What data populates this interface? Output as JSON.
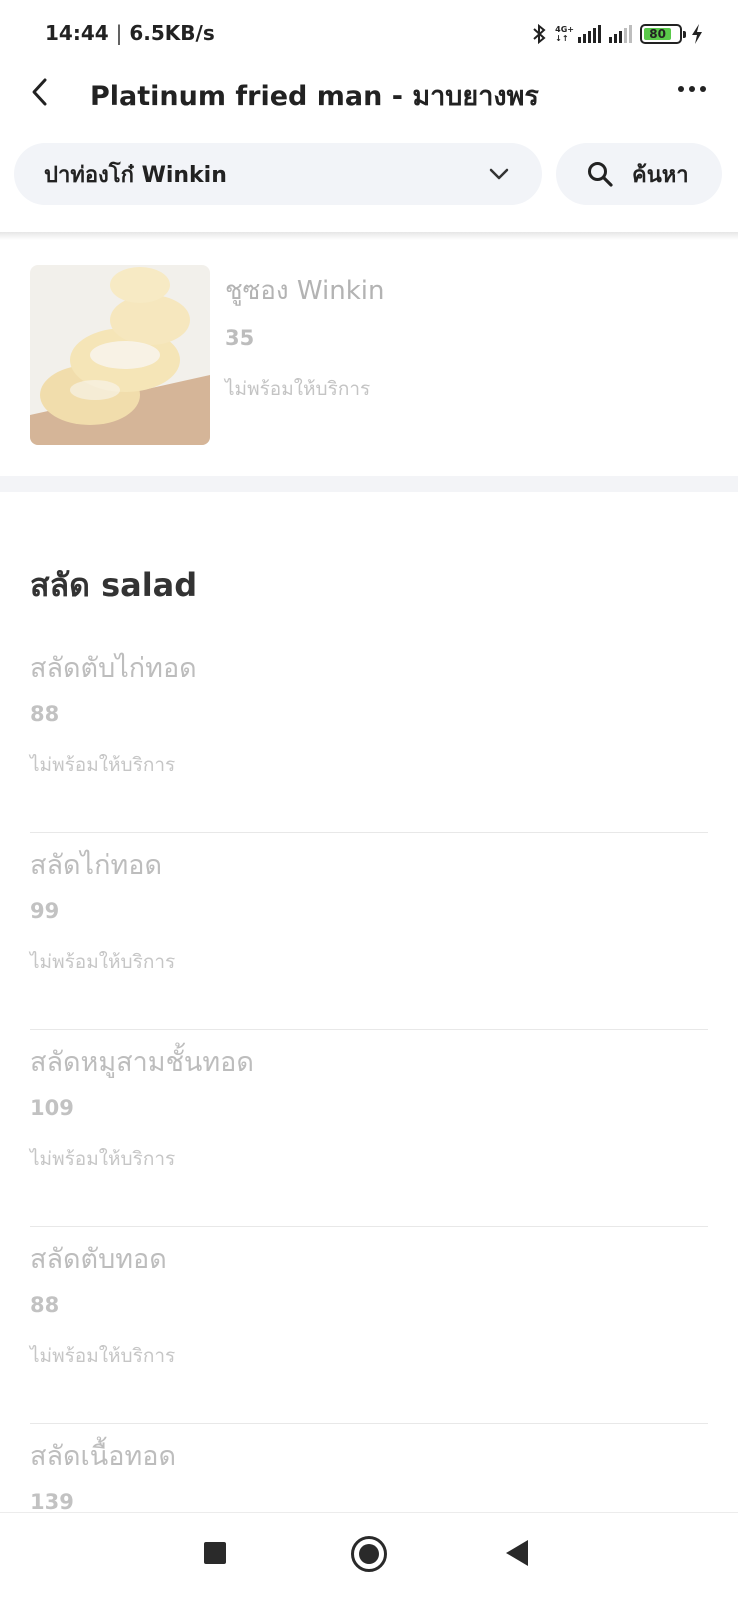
{
  "status_bar": {
    "time": "14:44",
    "separator": "|",
    "network_speed": "6.5KB/s",
    "network_type_top": "4G+",
    "network_type_bottom": "↓↑",
    "battery_level": "80",
    "icons": [
      "bluetooth-icon",
      "signal-4g-icon",
      "signal-icon",
      "battery-icon",
      "charging-icon"
    ]
  },
  "top_nav": {
    "title": "Platinum fried man - มาบยางพร"
  },
  "filter": {
    "category_value": "ปาท่องโก๋ Winkin",
    "search_label": "ค้นหา"
  },
  "featured_item": {
    "name": "ชูซอง Winkin",
    "price": "35",
    "status": "ไม่พร้อมให้บริการ"
  },
  "section": {
    "title": "สลัด salad",
    "items": [
      {
        "name": "สลัดตับไก่ทอด",
        "price": "88",
        "status": "ไม่พร้อมให้บริการ"
      },
      {
        "name": "สลัดไก่ทอด",
        "price": "99",
        "status": "ไม่พร้อมให้บริการ"
      },
      {
        "name": "สลัดหมูสามชั้นทอด",
        "price": "109",
        "status": "ไม่พร้อมให้บริการ"
      },
      {
        "name": "สลัดตับทอด",
        "price": "88",
        "status": "ไม่พร้อมให้บริการ"
      },
      {
        "name": "สลัดเนื้อทอด",
        "price": "139",
        "status": ""
      }
    ]
  },
  "colors": {
    "pill_background": "#f2f4f8",
    "battery_fill": "#5ac94a",
    "unavailable_text": "#bdbdbd"
  }
}
